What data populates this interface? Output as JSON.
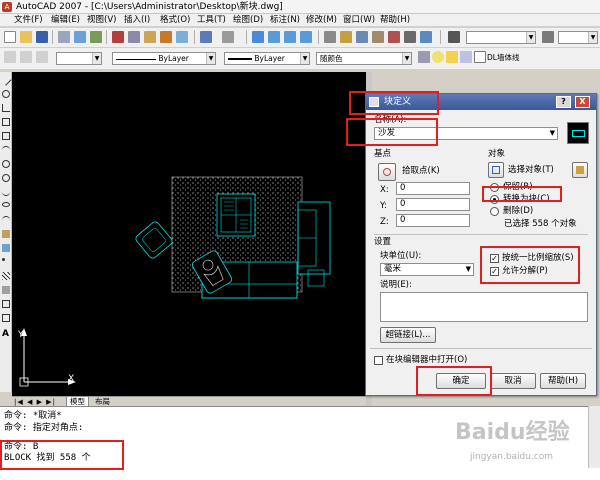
{
  "window": {
    "title": "AutoCAD 2007 - [C:\\Users\\Administrator\\Desktop\\新块.dwg]"
  },
  "menu": [
    "文件(F)",
    "编辑(E)",
    "视图(V)",
    "插入(I)",
    "格式(O)",
    "工具(T)",
    "绘图(D)",
    "标注(N)",
    "修改(M)",
    "窗口(W)",
    "帮助(H)"
  ],
  "properties_toolbar": {
    "linetype": "ByLayer",
    "lineweight": "ByLayer",
    "color": "随颜色",
    "layer": "DL墙体线"
  },
  "model_tabs": [
    "模型",
    "布局"
  ],
  "ucs": {
    "y_label": "Y",
    "x_label": "X"
  },
  "command_lines": [
    "命令: *取消*",
    "命令: 指定对角点:",
    "命令: B",
    "BLOCK 找到 558 个"
  ],
  "dialog": {
    "title": "块定义",
    "help_btn": "?",
    "close_btn": "X",
    "name_label": "名称(A):",
    "name_value": "沙发",
    "basepoint": {
      "section": "基点",
      "pick_label": "拾取点(K)",
      "x_label": "X:",
      "x_value": "0",
      "y_label": "Y:",
      "y_value": "0",
      "z_label": "Z:",
      "z_value": "0"
    },
    "objects": {
      "section": "对象",
      "select_label": "选择对象(T)",
      "retain": "保留(R)",
      "convert": "转换为块(C)",
      "delete": "删除(D)",
      "selected_count": "已选择 558 个对象"
    },
    "settings": {
      "section": "设置",
      "unit_label": "块单位(U):",
      "unit_value": "毫米",
      "desc_label": "说明(E):",
      "hyperlink_btn": "超链接(L)...",
      "scale_uniform": "按统一比例缩放(S)",
      "allow_explode": "允许分解(P)"
    },
    "open_in_editor": "在块编辑器中打开(O)",
    "ok": "确定",
    "cancel": "取消",
    "help": "帮助(H)"
  },
  "watermark": {
    "text": "Baidu经验",
    "url": "jingyan.baidu.com"
  },
  "colors": {
    "annotation_red": "#e02020",
    "cad_cyan": "#00e5e5",
    "dialog_title": "#3a5998"
  }
}
